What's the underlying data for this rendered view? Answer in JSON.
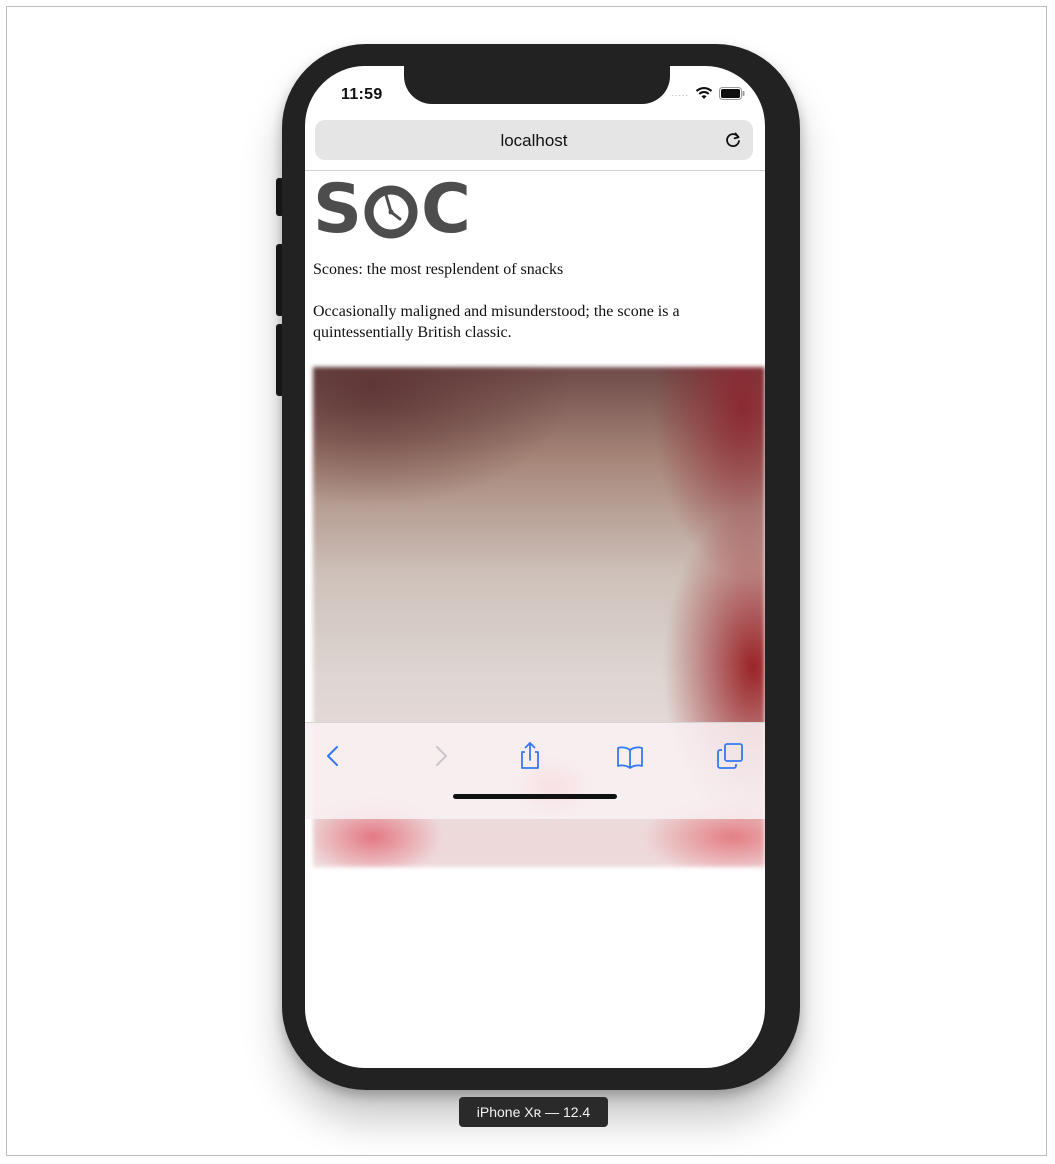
{
  "status_bar": {
    "time": "11:59",
    "signal": "....."
  },
  "browser": {
    "address": "localhost"
  },
  "page": {
    "logo": {
      "letter1": "S",
      "letter2": "C"
    },
    "tagline": "Scones: the most resplendent of snacks",
    "intro": "Occasionally maligned and misunderstood; the scone is a quintessentially British classic."
  },
  "toolbar": {
    "icons": [
      "back-icon",
      "forward-icon",
      "share-icon",
      "bookmarks-icon",
      "tabs-icon"
    ],
    "accent": "#3478f6"
  },
  "simulator": {
    "device_label": "iPhone Xʀ — 12.4"
  }
}
